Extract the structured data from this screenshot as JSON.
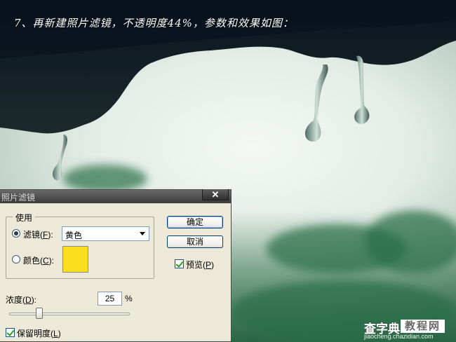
{
  "instruction": "7、再新建照片滤镜，不透明度44%，参数和效果如图：",
  "dialog": {
    "title": "照片滤镜",
    "close_glyph": "✕",
    "use_group": {
      "label": "使用",
      "filter_option": {
        "label": "滤镜",
        "mnemonic_prefix": "(",
        "mnemonic": "F",
        "mnemonic_suffix": "):",
        "selected": true
      },
      "filter_value": "黄色",
      "color_option": {
        "label": "颜色",
        "mnemonic_prefix": "(",
        "mnemonic": "C",
        "mnemonic_suffix": "):",
        "selected": false
      },
      "color_swatch": "#fbdf1e"
    },
    "ok_label": "确定",
    "cancel_label": "取消",
    "preview": {
      "label": "预览",
      "mnemonic_prefix": "(",
      "mnemonic": "P",
      "mnemonic_suffix": ")",
      "checked": true
    },
    "density": {
      "label": "浓度",
      "mnemonic_prefix": "(",
      "mnemonic": "D",
      "mnemonic_suffix": "):",
      "value": "25",
      "unit": "%",
      "slider_fraction": 0.25
    },
    "preserve_luminosity": {
      "label": "保留明度",
      "mnemonic_prefix": "(",
      "mnemonic": "L",
      "mnemonic_suffix": ")",
      "checked": true
    }
  },
  "watermark": {
    "main": "查字典",
    "boxed": "教程网",
    "url": "jiaocheng.chazidian.com"
  }
}
